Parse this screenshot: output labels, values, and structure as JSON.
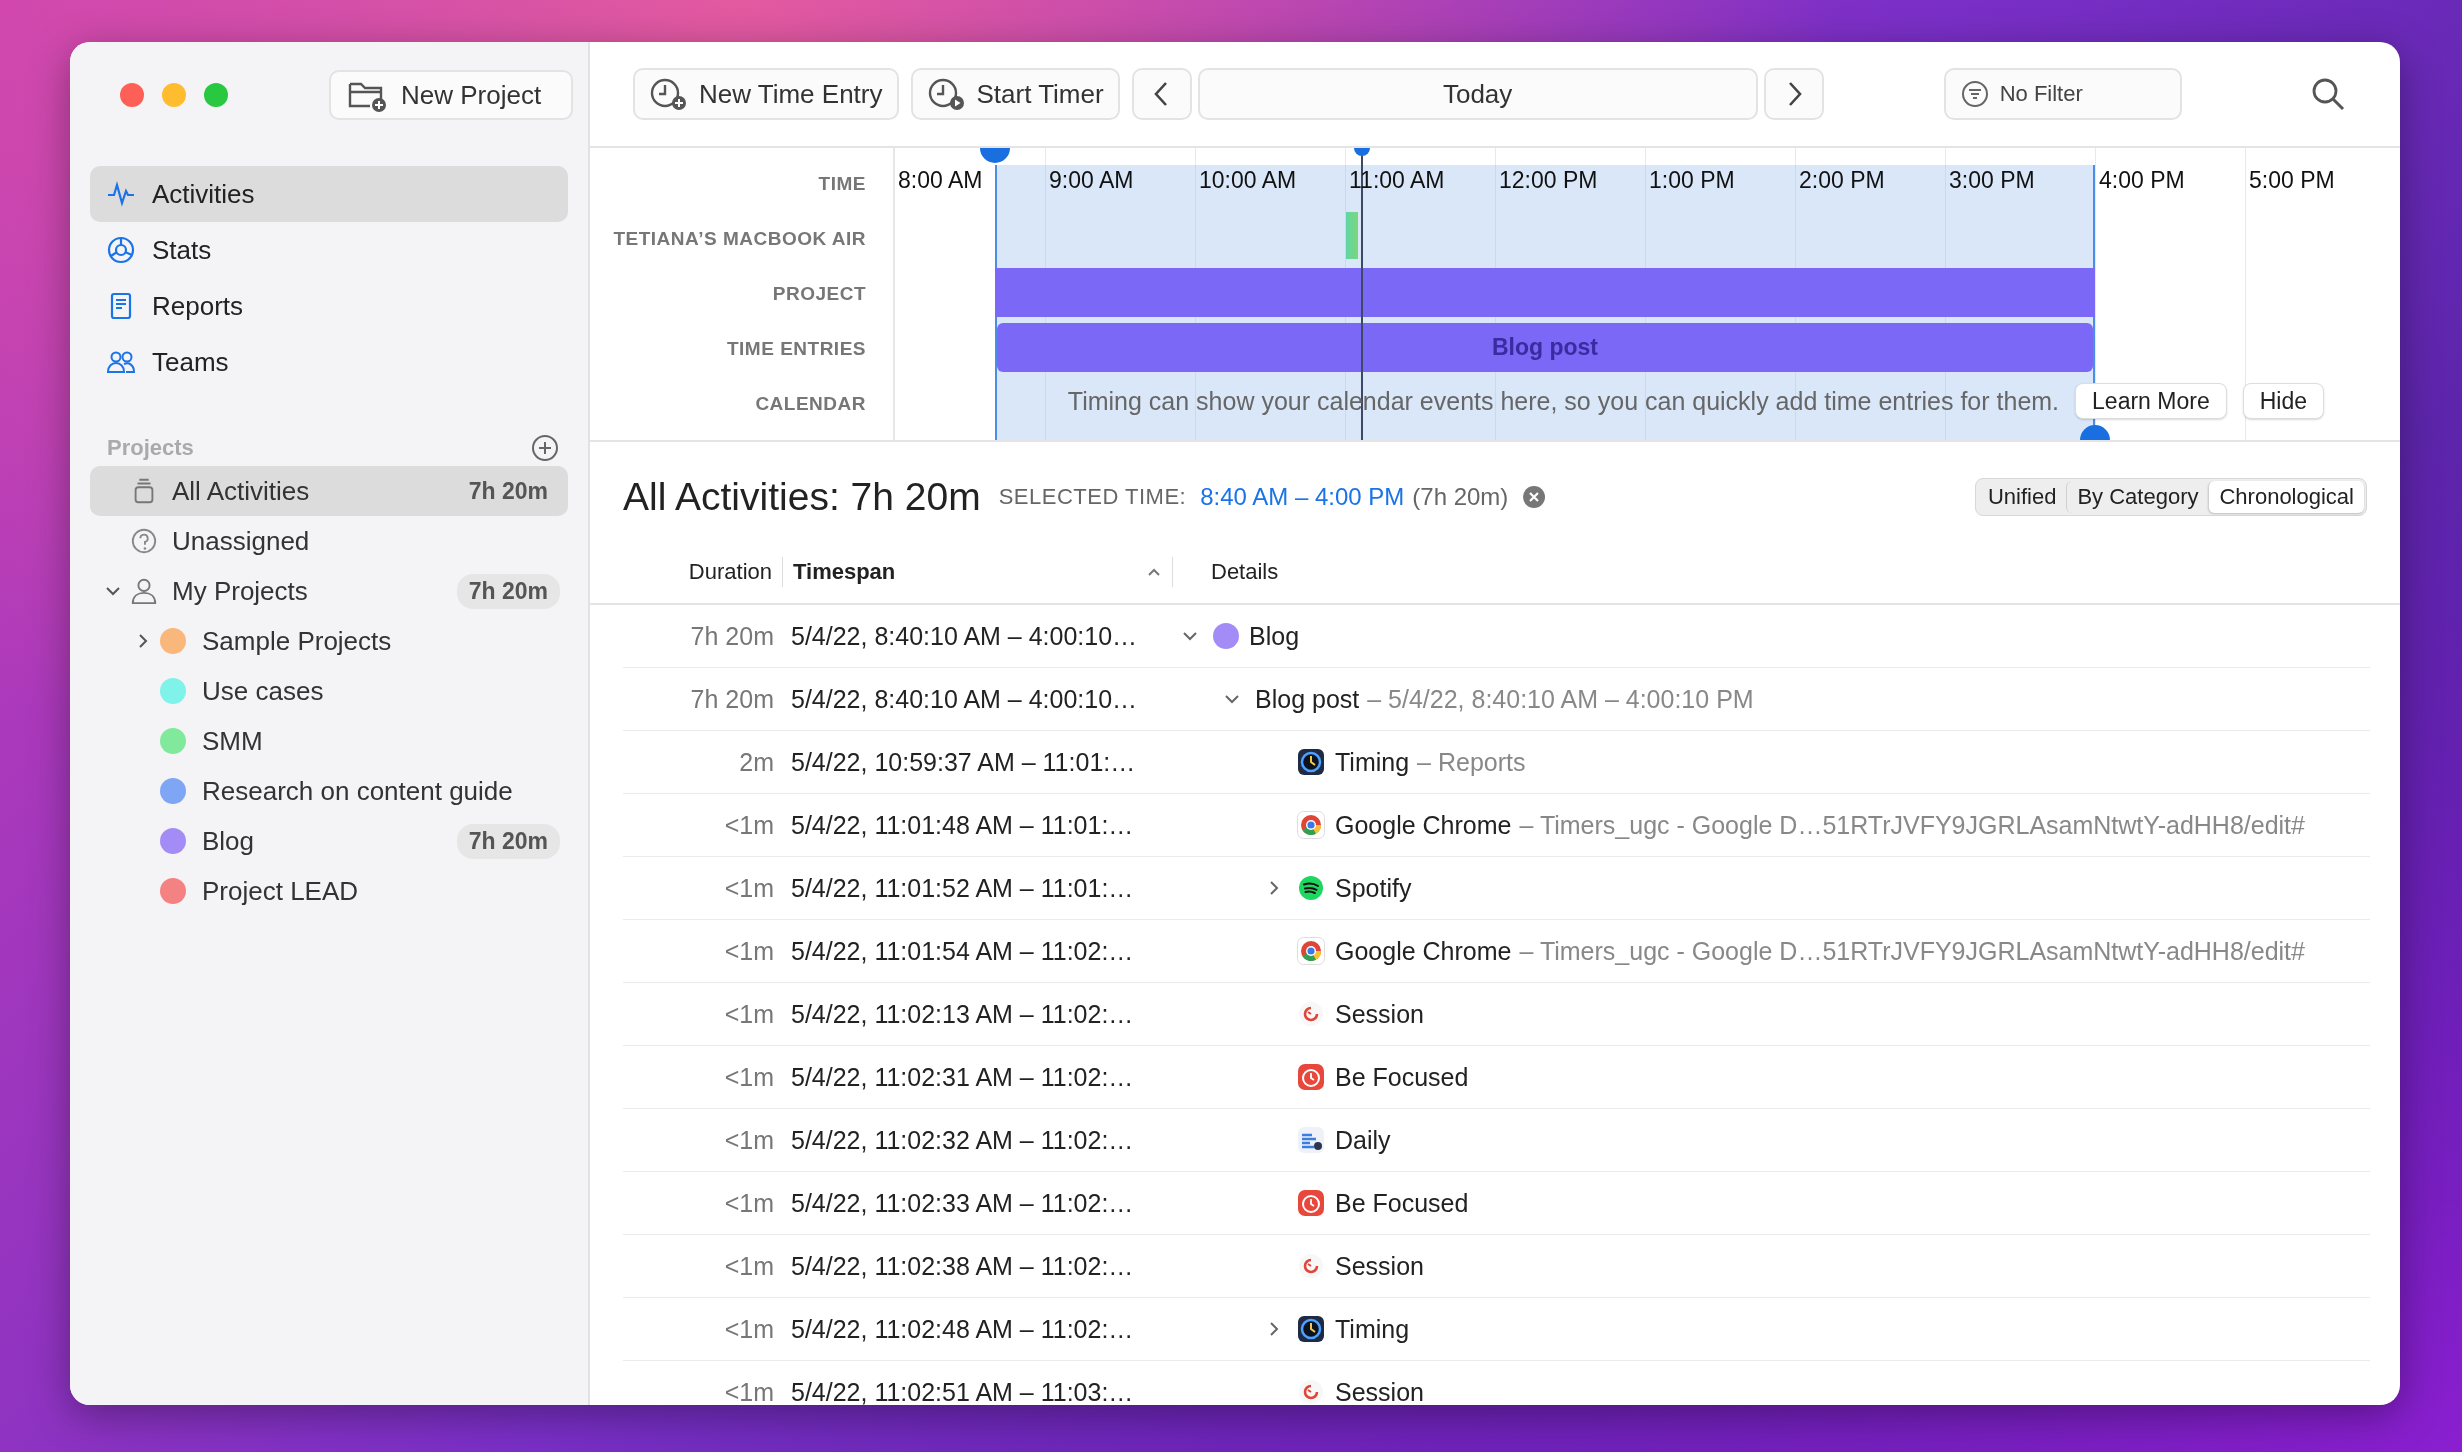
{
  "sidebar": {
    "new_project_button": "New Project",
    "nav": [
      {
        "label": "Activities",
        "kind": "activities",
        "selected": true
      },
      {
        "label": "Stats",
        "kind": "stats",
        "selected": false
      },
      {
        "label": "Reports",
        "kind": "reports",
        "selected": false
      },
      {
        "label": "Teams",
        "kind": "teams",
        "selected": false
      }
    ],
    "projects_header": "Projects",
    "projects": [
      {
        "label": "All Activities",
        "kind": "all",
        "duration": "7h 20m",
        "selected": true
      },
      {
        "label": "Unassigned",
        "kind": "unassigned",
        "selected": false
      },
      {
        "label": "My Projects",
        "kind": "group",
        "duration": "7h 20m",
        "expanded": true,
        "selected": false,
        "children": [
          {
            "label": "Sample Projects",
            "kind": "project",
            "color": "#f9b77c",
            "expanded": false,
            "selected": false
          },
          {
            "label": "Use cases",
            "kind": "project",
            "color": "#7ff3ea",
            "selected": false
          },
          {
            "label": "SMM",
            "kind": "project",
            "color": "#80e99b",
            "selected": false
          },
          {
            "label": "Research on content guide",
            "kind": "project",
            "color": "#7fa5f5",
            "selected": false
          },
          {
            "label": "Blog",
            "kind": "project",
            "color": "#a48cf7",
            "duration": "7h 20m",
            "selected": false
          },
          {
            "label": "Project LEAD",
            "kind": "project",
            "color": "#f58282",
            "selected": false
          }
        ]
      }
    ]
  },
  "toolbar": {
    "new_time_entry": "New Time Entry",
    "start_timer": "Start Timer",
    "date": "Today",
    "filter": "No Filter"
  },
  "timeline": {
    "row_labels": [
      "TIME",
      "TETIANA’S MACBOOK AIR",
      "PROJECT",
      "TIME ENTRIES",
      "CALENDAR"
    ],
    "hours": [
      "8:00 AM",
      "9:00 AM",
      "10:00 AM",
      "11:00 AM",
      "12:00 PM",
      "1:00 PM",
      "2:00 PM",
      "3:00 PM",
      "4:00 PM",
      "5:00 PM"
    ],
    "time_entry": "Blog post",
    "calendar_hint": "Timing can show your calendar events here, so you can quickly add time entries for them.",
    "learn_more": "Learn More",
    "hide": "Hide"
  },
  "summary": {
    "title": "All Activities: 7h 20m",
    "selected_time_label": "SELECTED TIME:",
    "selected_time": "8:40 AM – 4:00 PM",
    "selected_duration": "(7h 20m)",
    "view_modes": [
      {
        "label": "Unified",
        "selected": false
      },
      {
        "label": "By Category",
        "selected": false
      },
      {
        "label": "Chronological",
        "selected": true
      }
    ]
  },
  "table": {
    "columns": [
      {
        "label": "Duration",
        "sorted": false
      },
      {
        "label": "Timespan",
        "sorted": true
      },
      {
        "label": "Details",
        "sorted": false
      }
    ],
    "rows": [
      {
        "duration": "7h 20m",
        "timespan": "5/4/22, 8:40:10 AM – 4:00:10…",
        "kind": "project",
        "color": "#a48cf7",
        "title": "Blog",
        "expanded": true,
        "children": [
          {
            "duration": "7h 20m",
            "timespan": "5/4/22, 8:40:10 AM – 4:00:10…",
            "title": "Blog post",
            "suffix": "– 5/4/22, 8:40:10 AM – 4:00:10 PM",
            "expanded": true,
            "children": [
              {
                "duration": "2m",
                "timespan": "5/4/22, 10:59:37 AM – 11:01:…",
                "kind": "timing-app",
                "title": "Timing",
                "suffix": "– Reports"
              },
              {
                "duration": "<1m",
                "timespan": "5/4/22, 11:01:48 AM – 11:01:…",
                "kind": "browser-app",
                "title": "Google Chrome",
                "suffix": "– Timers_ugc - Google D…51RTrJVFY9JGRLAsamNtwtY-adHH8/edit#"
              },
              {
                "duration": "<1m",
                "timespan": "5/4/22, 11:01:52 AM – 11:01:…",
                "kind": "music-app",
                "title": "Spotify",
                "expanded": false
              },
              {
                "duration": "<1m",
                "timespan": "5/4/22, 11:01:54 AM – 11:02:…",
                "kind": "browser-app",
                "title": "Google Chrome",
                "suffix": "– Timers_ugc - Google D…51RTrJVFY9JGRLAsamNtwtY-adHH8/edit#"
              },
              {
                "duration": "<1m",
                "timespan": "5/4/22, 11:02:13 AM – 11:02:…",
                "kind": "session-app",
                "title": "Session"
              },
              {
                "duration": "<1m",
                "timespan": "5/4/22, 11:02:31 AM – 11:02:…",
                "kind": "focus-app",
                "title": "Be Focused"
              },
              {
                "duration": "<1m",
                "timespan": "5/4/22, 11:02:32 AM – 11:02:…",
                "kind": "daily-app",
                "title": "Daily"
              },
              {
                "duration": "<1m",
                "timespan": "5/4/22, 11:02:33 AM – 11:02:…",
                "kind": "focus-app",
                "title": "Be Focused"
              },
              {
                "duration": "<1m",
                "timespan": "5/4/22, 11:02:38 AM – 11:02:…",
                "kind": "session-app",
                "title": "Session"
              },
              {
                "duration": "<1m",
                "timespan": "5/4/22, 11:02:48 AM – 11:02:…",
                "kind": "timing-app",
                "title": "Timing",
                "expanded": false
              },
              {
                "duration": "<1m",
                "timespan": "5/4/22, 11:02:51 AM – 11:03:…",
                "kind": "session-app",
                "title": "Session"
              }
            ]
          }
        ]
      }
    ]
  }
}
